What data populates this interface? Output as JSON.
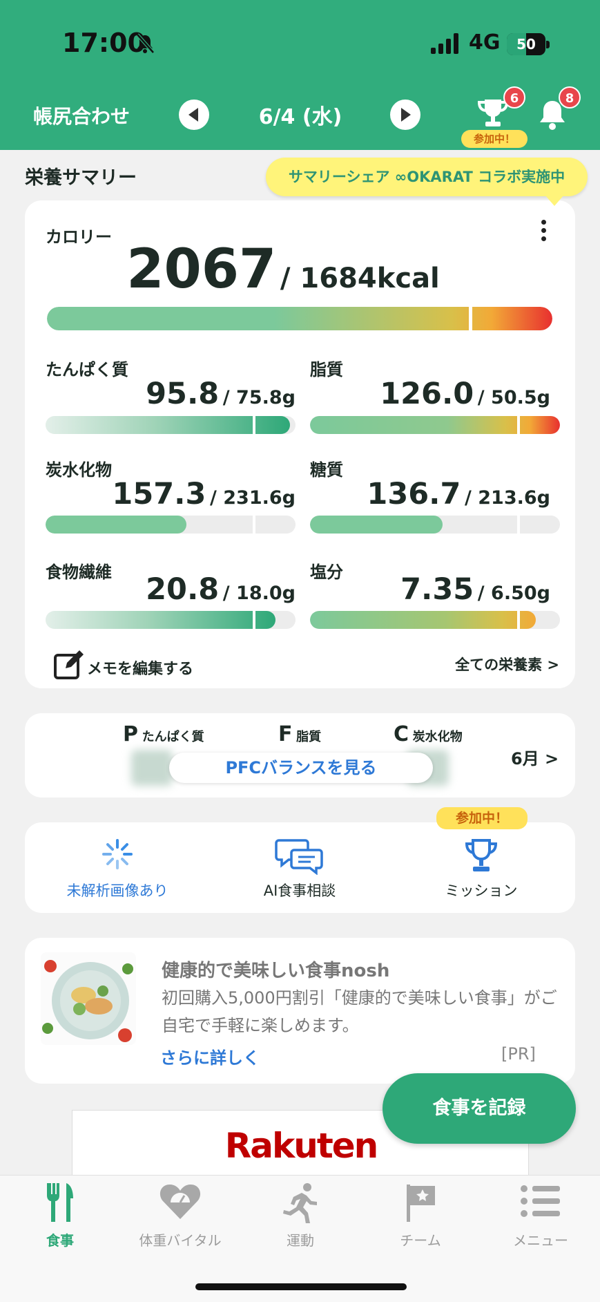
{
  "status_bar": {
    "time": "17:00",
    "network": "4G",
    "battery": "50",
    "battery_level": 0.5
  },
  "header": {
    "title": "帳尻合わせ",
    "date": "6/4 (水)",
    "trophy_badge": "6",
    "trophy_tag": "参加中！",
    "bell_badge": "8"
  },
  "summary": {
    "heading": "栄養サマリー",
    "tooltip": "サマリーシェア ∞OKARAT コラボ実施中",
    "calorie": {
      "label": "カロリー",
      "value": "2067",
      "target": "/ 1684kcal",
      "ratio": 1.23
    },
    "nutrients": [
      {
        "label": "たんぱく質",
        "value": "95.8",
        "target": "/ 75.8g",
        "ratio": 1.26,
        "style": "over-green"
      },
      {
        "label": "脂質",
        "value": "126.0",
        "target": "/ 50.5g",
        "ratio": 2.49,
        "style": "over-red"
      },
      {
        "label": "炭水化物",
        "value": "157.3",
        "target": "/ 231.6g",
        "ratio": 0.68,
        "style": "under"
      },
      {
        "label": "糖質",
        "value": "136.7",
        "target": "/ 213.6g",
        "ratio": 0.64,
        "style": "under"
      },
      {
        "label": "食物繊維",
        "value": "20.8",
        "target": "/ 18.0g",
        "ratio": 1.16,
        "style": "over-green"
      },
      {
        "label": "塩分",
        "value": "7.35",
        "target": "/ 6.50g",
        "ratio": 1.13,
        "style": "over-orange"
      }
    ],
    "memo_label": "メモを編集する",
    "all_nutrients_link": "全ての栄養素 >"
  },
  "pfc": {
    "p_letter": "P",
    "p_label": "たんぱく質",
    "f_letter": "F",
    "f_label": "脂質",
    "c_letter": "C",
    "c_label": "炭水化物",
    "button": "PFCバランスを見る",
    "month_link": "6月 >"
  },
  "quick_actions": {
    "unanalyzed": "未解析画像あり",
    "ai_consult": "AI食事相談",
    "mission": "ミッション",
    "mission_tag": "参加中！"
  },
  "ad": {
    "title": "健康的で美味しい食事nosh",
    "body": "初回購入5,000円割引「健康的で美味しい食事」がご自宅で手軽に楽しめます。",
    "more": "さらに詳しく",
    "pr": "[PR]"
  },
  "banner": {
    "brand": "Rakuten"
  },
  "fab": {
    "label": "食事を記録"
  },
  "tabs": [
    {
      "label": "食事",
      "active": true
    },
    {
      "label": "体重バイタル",
      "active": false
    },
    {
      "label": "運動",
      "active": false
    },
    {
      "label": "チーム",
      "active": false
    },
    {
      "label": "メニュー",
      "active": false
    }
  ],
  "colors": {
    "brand_green": "#31ad7d",
    "badge_red": "#e8464b",
    "link_blue": "#2e79d6",
    "tag_yellow": "#ffe15a"
  }
}
